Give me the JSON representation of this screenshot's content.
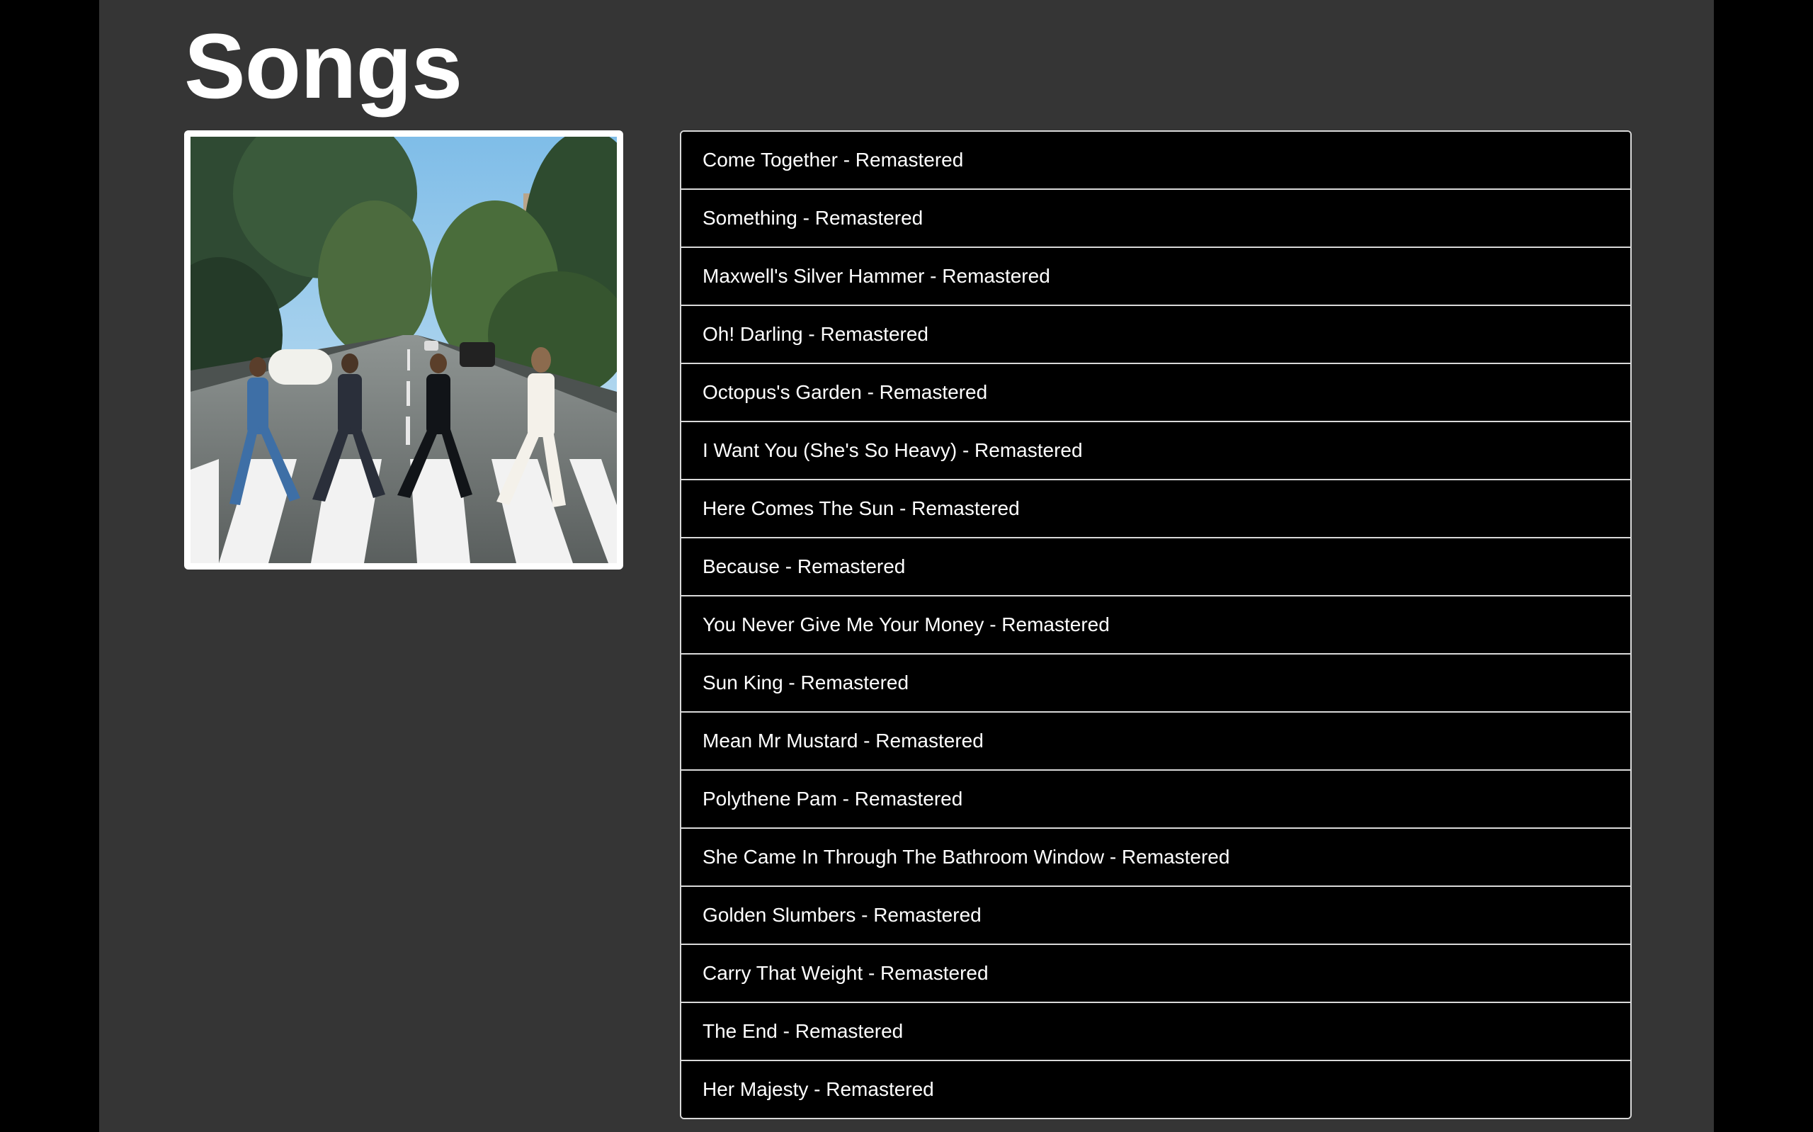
{
  "page": {
    "title": "Songs"
  },
  "album": {
    "cover_icon": "album-cover-image"
  },
  "songs": [
    "Come Together - Remastered",
    "Something - Remastered",
    "Maxwell's Silver Hammer - Remastered",
    "Oh! Darling - Remastered",
    "Octopus's Garden - Remastered",
    "I Want You (She's So Heavy) - Remastered",
    "Here Comes The Sun - Remastered",
    "Because - Remastered",
    "You Never Give Me Your Money - Remastered",
    "Sun King - Remastered",
    "Mean Mr Mustard - Remastered",
    "Polythene Pam - Remastered",
    "She Came In Through The Bathroom Window - Remastered",
    "Golden Slumbers - Remastered",
    "Carry That Weight - Remastered",
    "The End - Remastered",
    "Her Majesty - Remastered"
  ],
  "colors": {
    "outer_background": "#000000",
    "panel_background": "#353535",
    "list_background": "#000000",
    "list_border": "#d9d9d9",
    "text": "#ffffff"
  }
}
